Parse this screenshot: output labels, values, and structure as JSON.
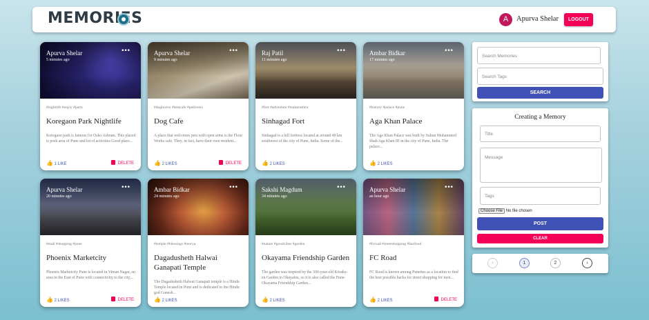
{
  "app": {
    "title": "MEMORIES"
  },
  "user": {
    "initial": "A",
    "name": "Apurva Shelar",
    "logout_label": "LOGOUT"
  },
  "posts": [
    {
      "creator": "Apurva Shelar",
      "time": "5 minutes ago",
      "tags": "#nightlife #enjoy #party",
      "title": "Koregaon Park Nightlife",
      "message": "Koregaon park is famous for Osho Ashram. This placed is posh area of Pune and lot of activities Good place...",
      "likes": "1 LIKE",
      "delete": "DELETE"
    },
    {
      "creator": "Apurva Shelar",
      "time": "9 minutes ago",
      "tags": "#doglovers #bestcafe #petlovers",
      "title": "Dog Cafe",
      "message": "A place that welcomes pets with open arms is the Flour Works cafe. They, in fact, have their own resident...",
      "likes": "2 LIKES",
      "delete": "DELETE"
    },
    {
      "creator": "Raj Patil",
      "time": "11 minutes ago",
      "tags": "#fort #adventure #maharashtra",
      "title": "Sinhagad Fort",
      "message": "Sinhagad is a hill fortress located at around 49 km southwest of the city of Pune, India. Some of the...",
      "likes": "2 LIKES"
    },
    {
      "creator": "Ambar Bidkar",
      "time": "17 minutes ago",
      "tags": "#history #palace #pune",
      "title": "Aga Khan Palace",
      "message": "The Aga Khan Palace was built by Sultan Muhammed Shah Aga Khan III in the city of Pune, India. The palace...",
      "likes": "2 LIKES"
    },
    {
      "creator": "Apurva Shelar",
      "time": "20 minutes ago",
      "tags": "#mall #shopping #pune",
      "title": "Phoenix Marketcity",
      "message": "Phoenix Marketcity Pune is located in Viman Nagar, an area in the East of Pune with connectivity to the city,...",
      "likes": "2 LIKES",
      "delete": "DELETE"
    },
    {
      "creator": "Ambar Bidkar",
      "time": "24 minutes ago",
      "tags": "#temple #blessings #morya",
      "title": "Dagadusheth Halwai Ganapati Temple",
      "message": "The Dagadusheth Halwai Ganapati temple is a Hindu Temple located in Pune and is dedicated to the Hindu god Ganesh...",
      "likes": "2 LIKES"
    },
    {
      "creator": "Sakshi Magdum",
      "time": "34 minutes ago",
      "tags": "#nature #goodvibes #garden",
      "title": "Okayama Friendship Garden",
      "message": "The garden was inspired by the 300-year-old Kōraku-en Garden in Okayama, so it is also called the Pune-Okayama Friendship Garden...",
      "likes": "2 LIKES"
    },
    {
      "creator": "Apurva Shelar",
      "time": "an hour ago",
      "tags": "#fcroad #streetshopping #fastfood",
      "title": "FC Road",
      "message": "FC Road is known among Puneites as a location to find the best possible hacks for street shopping for men...",
      "likes": "2 LIKES",
      "delete": "DELETE"
    }
  ],
  "search": {
    "memories_placeholder": "Search Memories",
    "tags_placeholder": "Search Tags",
    "button_label": "SEARCH"
  },
  "form": {
    "heading": "Creating a Memory",
    "title_placeholder": "Title",
    "message_placeholder": "Message",
    "tags_placeholder": "Tags",
    "file_button": "Choose File",
    "file_status": "No file chosen",
    "submit_label": "POST",
    "clear_label": "CLEAR"
  },
  "pagination": {
    "prev": "‹",
    "pages": [
      "1",
      "2"
    ],
    "next": "›",
    "current": "1"
  },
  "colors": {
    "primary": "#3f51b5",
    "secondary": "#f50057",
    "avatar": "#c2185b"
  }
}
